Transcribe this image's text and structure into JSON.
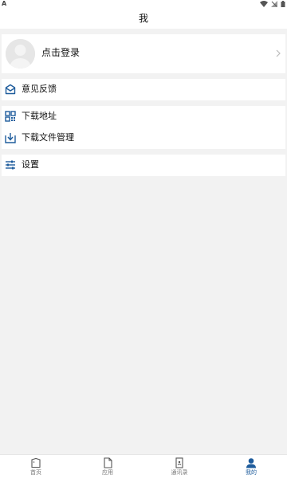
{
  "status_bar": {
    "left_glyph": "A",
    "icons": [
      "wifi-icon",
      "signal-icon",
      "battery-icon"
    ]
  },
  "header": {
    "title": "我"
  },
  "profile": {
    "login_label": "点击登录"
  },
  "menu": {
    "feedback": {
      "label": "意见反馈",
      "icon": "mail-icon"
    },
    "download_address": {
      "label": "下载地址",
      "icon": "qr-code-icon"
    },
    "download_manager": {
      "label": "下载文件管理",
      "icon": "download-icon"
    },
    "settings": {
      "label": "设置",
      "icon": "sliders-icon"
    }
  },
  "tabbar": {
    "tabs": [
      {
        "label": "首页",
        "icon": "home-icon",
        "active": false
      },
      {
        "label": "应用",
        "icon": "file-icon",
        "active": false
      },
      {
        "label": "通讯录",
        "icon": "contacts-icon",
        "active": false
      },
      {
        "label": "我的",
        "icon": "user-icon",
        "active": true
      }
    ]
  },
  "colors": {
    "accent": "#1e5c9c",
    "background": "#f2f2f2",
    "card": "#ffffff",
    "inactive": "#777777"
  }
}
